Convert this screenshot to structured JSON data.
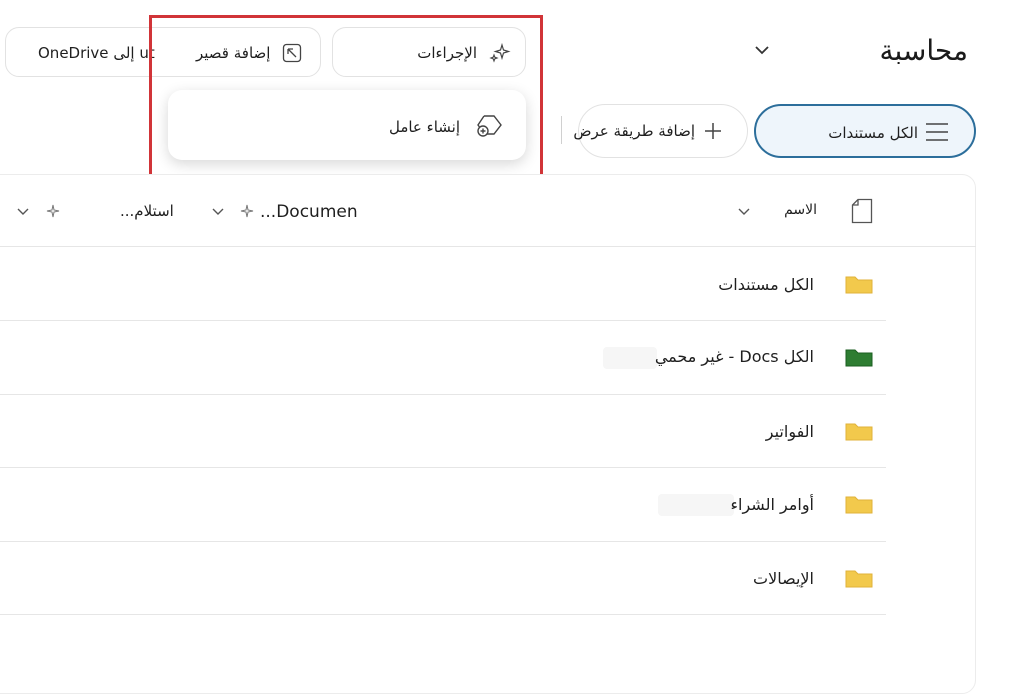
{
  "page": {
    "title": "محاسبة"
  },
  "toolbar": {
    "actions_label": "الإجراءات",
    "shortcut_label": "إضافة قصير",
    "shortcut_suffix": "ut إلى OneDrive"
  },
  "actions_menu": {
    "items": [
      {
        "label": "إنشاء عامل",
        "icon": "agent-add-icon"
      }
    ]
  },
  "views": {
    "current_view": "الكل مستندات",
    "add_view_label": "إضافة طريقة عرض"
  },
  "columns": {
    "name": "الاسم",
    "documen": "Documen...",
    "estelam": "استلام..."
  },
  "rows": [
    {
      "name": "الكل مستندات",
      "folder_color": "#f2c94c"
    },
    {
      "name": "الكل Docs - غير محمي",
      "folder_color": "#2e7d32"
    },
    {
      "name": "الفواتير",
      "folder_color": "#f2c94c"
    },
    {
      "name": "أوامر الشراء",
      "folder_color": "#f2c94c"
    },
    {
      "name": "الإيصالات",
      "folder_color": "#f2c94c"
    }
  ],
  "colors": {
    "accent": "#2c6e9b",
    "highlight": "#d13438"
  }
}
